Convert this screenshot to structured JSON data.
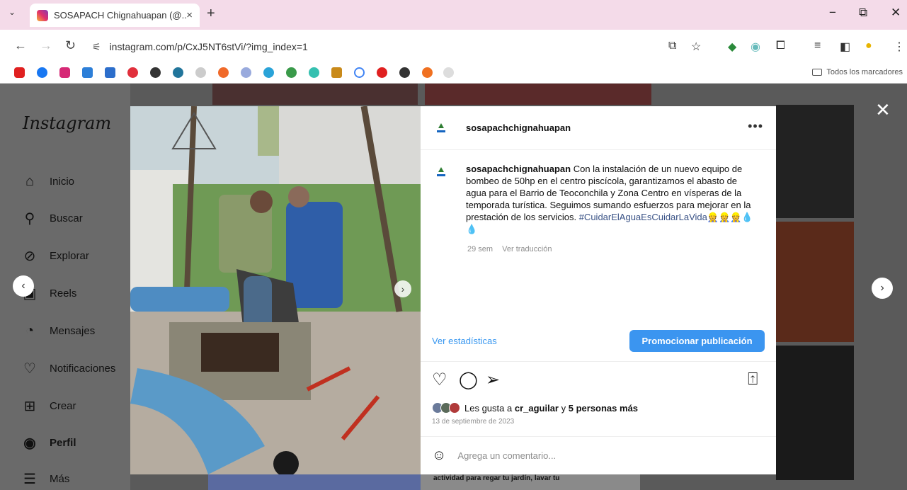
{
  "browser": {
    "tab_title": "SOSAPACH Chignahuapan (@...",
    "url": "instagram.com/p/CxJ5NT6stVi/?img_index=1",
    "bookmarks_all": "Todos los marcadores",
    "minimize": "−",
    "restore": "⧉",
    "close": "✕"
  },
  "sidebar": {
    "logo": "Instagram",
    "items": [
      {
        "label": "Inicio",
        "icon": "home-icon"
      },
      {
        "label": "Buscar",
        "icon": "search-icon"
      },
      {
        "label": "Explorar",
        "icon": "compass-icon"
      },
      {
        "label": "Reels",
        "icon": "reels-icon"
      },
      {
        "label": "Mensajes",
        "icon": "messenger-icon"
      },
      {
        "label": "Notificaciones",
        "icon": "heart-icon"
      },
      {
        "label": "Crear",
        "icon": "plus-square-icon"
      },
      {
        "label": "Perfil",
        "icon": "profile-icon"
      },
      {
        "label": "Más",
        "icon": "menu-icon"
      }
    ]
  },
  "post": {
    "username": "sosapachchignahuapan",
    "caption": "Con la instalación de un nuevo equipo de bombeo de 50hp en el centro piscícola, garantizamos el abasto de agua para el Barrio de Teoconchila y Zona Centro en vísperas de la temporada turística. Seguimos sumando esfuerzos para mejorar en la prestación de los servicios.",
    "hashtag": "#CuidarElAguaEsCuidarLaVida",
    "emoji": "👷👷👷💧💧",
    "age": "29 sem",
    "translate": "Ver traducción",
    "stats_link": "Ver estadísticas",
    "promote_button": "Promocionar publicación",
    "likes_prefix": "Les gusta a",
    "likes_user": "cr_aguilar",
    "likes_connector": "y",
    "likes_count": "5 personas más",
    "date": "13 de septiembre de 2023",
    "comment_placeholder": "Agrega un comentario...",
    "background_text": "actividad para regar tu jardín, lavar tu"
  },
  "colors": {
    "accent": "#3b95f0",
    "link": "#385185"
  }
}
